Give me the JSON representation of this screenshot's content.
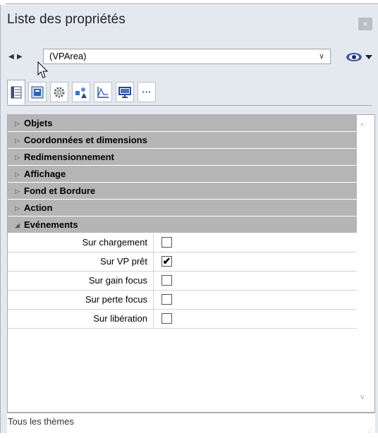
{
  "window": {
    "title": "Liste des propriétés",
    "close_label": "×"
  },
  "navigator": {
    "prev_glyph": "◀",
    "next_glyph": "▶",
    "selected_object": "(VPArea)",
    "eye_icon": "eye-icon"
  },
  "tabs": [
    {
      "name": "list-tab",
      "icon": "list-icon",
      "selected": true
    },
    {
      "name": "properties-tab",
      "icon": "blue-square-icon"
    },
    {
      "name": "gear-tab",
      "icon": "gear-icon"
    },
    {
      "name": "shapes-tab",
      "icon": "shapes-icon"
    },
    {
      "name": "chart-tab",
      "icon": "chart-icon"
    },
    {
      "name": "display-tab",
      "icon": "monitor-icon"
    },
    {
      "name": "more-tab",
      "icon": "ellipsis-icon",
      "label": "···"
    }
  ],
  "sections": [
    {
      "label": "Objets",
      "expanded": false
    },
    {
      "label": "Coordonnées et dimensions",
      "expanded": false
    },
    {
      "label": "Redimensionnement",
      "expanded": false
    },
    {
      "label": "Affichage",
      "expanded": false
    },
    {
      "label": "Fond et Bordure",
      "expanded": false
    },
    {
      "label": "Action",
      "expanded": false
    },
    {
      "label": "Evénements",
      "expanded": true
    }
  ],
  "events": [
    {
      "label": "Sur chargement",
      "checked": false,
      "mark": ""
    },
    {
      "label": "Sur VP prêt",
      "checked": true,
      "mark": "✔"
    },
    {
      "label": "Sur gain focus",
      "checked": false,
      "mark": ""
    },
    {
      "label": "Sur perte focus",
      "checked": false,
      "mark": ""
    },
    {
      "label": "Sur libération",
      "checked": false,
      "mark": ""
    }
  ],
  "glyphs": {
    "collapsed": "▷",
    "expanded": "◢",
    "scroll_up": "^",
    "scroll_down": "v",
    "grip": ".:"
  },
  "footer": {
    "label": "Tous les thèmes"
  }
}
